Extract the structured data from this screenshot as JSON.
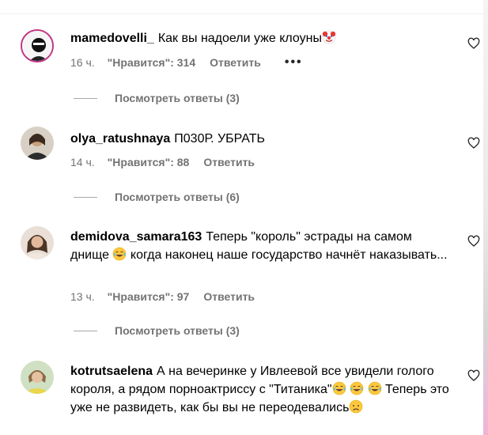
{
  "comments": [
    {
      "username": "mamedovelli_",
      "text_parts": [
        "Как вы надоели уже клоуны"
      ],
      "time": "16 ч.",
      "likes": "\"Нравится\": 314",
      "reply": "Ответить",
      "more": "•••",
      "view_replies": "Посмотреть ответы (3)"
    },
    {
      "username": "olya_ratushnaya",
      "text_parts": [
        "П030Р. УБРАТЬ"
      ],
      "time": "14 ч.",
      "likes": "\"Нравится\": 88",
      "reply": "Ответить",
      "view_replies": "Посмотреть ответы (6)"
    },
    {
      "username": "demidova_samara163",
      "text_parts": [
        "Теперь \"король\" эстрады на самом днище",
        "когда наконец наше государство начнёт наказывать..."
      ],
      "time": "13 ч.",
      "likes": "\"Нравится\": 97",
      "reply": "Ответить",
      "view_replies": "Посмотреть ответы (3)"
    },
    {
      "username": "kotrutsaelena",
      "text_parts": [
        "А на вечеринке у Ивлеевой все увидели голого короля, а рядом порноактриссу с \"Титаника\"",
        "Теперь это уже не развидеть, как бы вы не переодевались"
      ]
    }
  ],
  "icons": {
    "heart": "heart-outline-icon",
    "clown": "clown-face-emoji",
    "laugh": "face-with-tears-of-joy-emoji",
    "sad": "disappointed-face-emoji"
  },
  "colors": {
    "meta_text": "#737373",
    "replies_line": "#a8a8a8"
  }
}
